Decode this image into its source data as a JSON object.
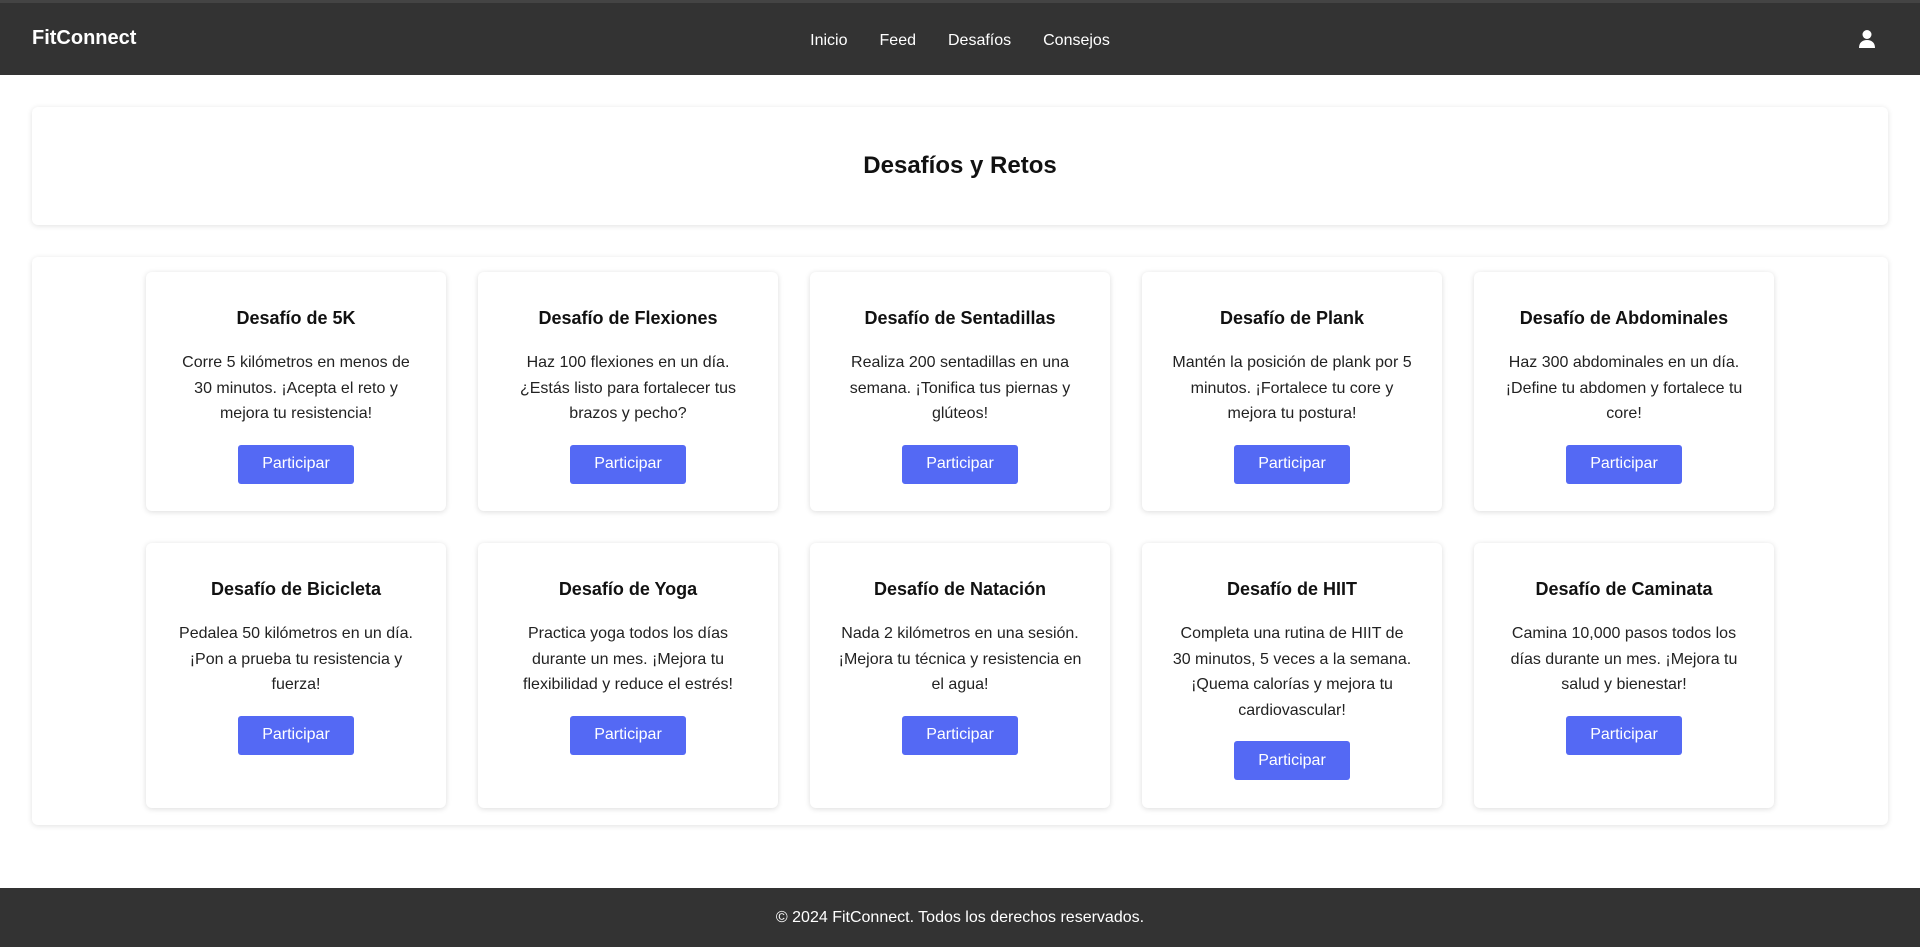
{
  "navbar": {
    "brand": "FitConnect",
    "links": [
      {
        "label": "Inicio"
      },
      {
        "label": "Feed"
      },
      {
        "label": "Desafíos"
      },
      {
        "label": "Consejos"
      }
    ],
    "user_icon": "user-icon",
    "background": "#333333"
  },
  "header": {
    "title": "Desafíos y Retos"
  },
  "challenges": [
    {
      "title": "Desafío de 5K",
      "description": "Corre 5 kilómetros en menos de 30 minutos. ¡Acepta el reto y mejora tu resistencia!",
      "button": "Participar"
    },
    {
      "title": "Desafío de Flexiones",
      "description": "Haz 100 flexiones en un día. ¿Estás listo para fortalecer tus brazos y pecho?",
      "button": "Participar"
    },
    {
      "title": "Desafío de Sentadillas",
      "description": "Realiza 200 sentadillas en una semana. ¡Tonifica tus piernas y glúteos!",
      "button": "Participar"
    },
    {
      "title": "Desafío de Plank",
      "description": "Mantén la posición de plank por 5 minutos. ¡Fortalece tu core y mejora tu postura!",
      "button": "Participar"
    },
    {
      "title": "Desafío de Abdominales",
      "description": "Haz 300 abdominales en un día. ¡Define tu abdomen y fortalece tu core!",
      "button": "Participar"
    },
    {
      "title": "Desafío de Bicicleta",
      "description": "Pedalea 50 kilómetros en un día. ¡Pon a prueba tu resistencia y fuerza!",
      "button": "Participar"
    },
    {
      "title": "Desafío de Yoga",
      "description": "Practica yoga todos los días durante un mes. ¡Mejora tu flexibilidad y reduce el estrés!",
      "button": "Participar"
    },
    {
      "title": "Desafío de Natación",
      "description": "Nada 2 kilómetros en una sesión. ¡Mejora tu técnica y resistencia en el agua!",
      "button": "Participar"
    },
    {
      "title": "Desafío de HIIT",
      "description": "Completa una rutina de HIIT de 30 minutos, 5 veces a la semana. ¡Quema calorías y mejora tu cardiovascular!",
      "button": "Participar"
    },
    {
      "title": "Desafío de Caminata",
      "description": "Camina 10,000 pasos todos los días durante un mes. ¡Mejora tu salud y bienestar!",
      "button": "Participar"
    }
  ],
  "footer": {
    "text": "© 2024 FitConnect. Todos los derechos reservados."
  },
  "colors": {
    "accent": "#5469f4",
    "dark": "#333333"
  }
}
